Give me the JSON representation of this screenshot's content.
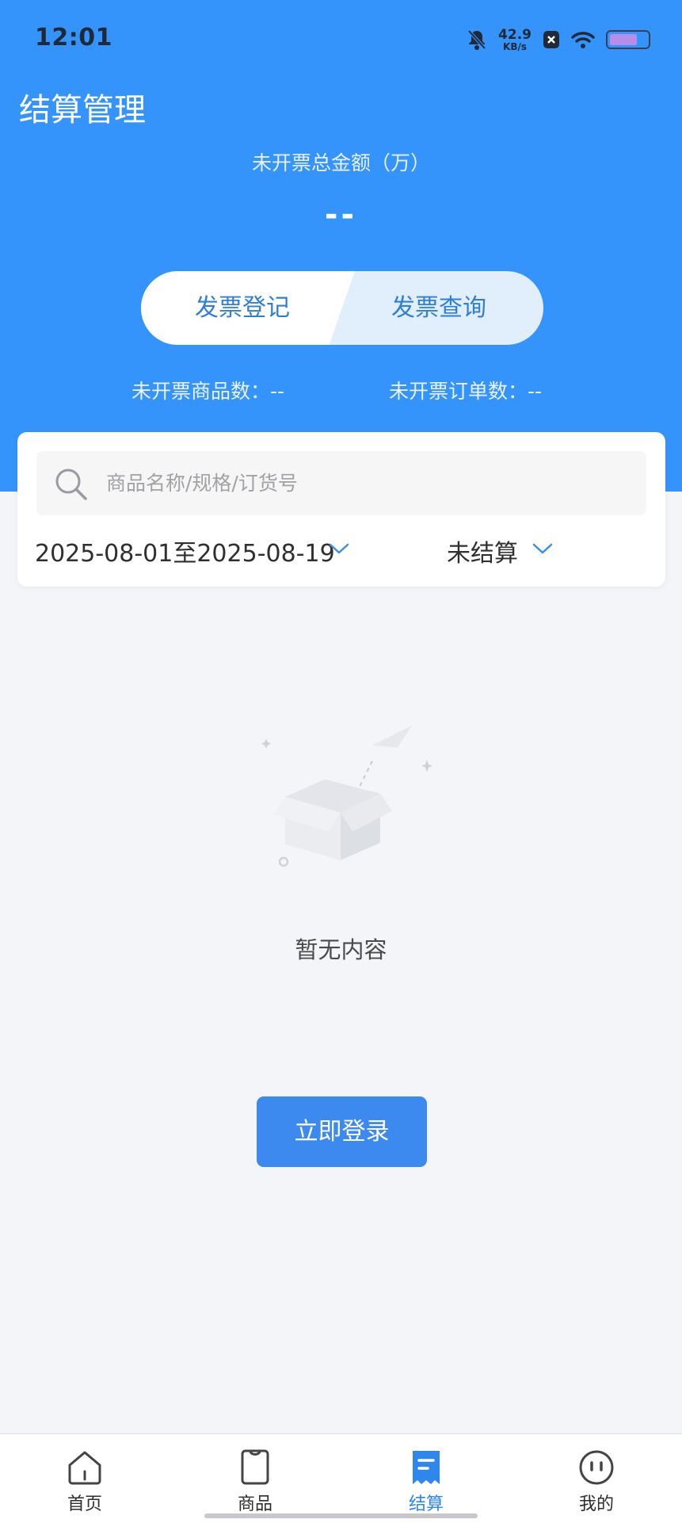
{
  "status_bar": {
    "time": "12:01",
    "net_speed_value": "42.9",
    "net_speed_unit": "KB/s"
  },
  "header": {
    "title": "结算管理",
    "total_label": "未开票总金额（万）",
    "total_value": "--"
  },
  "segment": {
    "left_label": "发票登记",
    "right_label": "发票查询",
    "selected": "发票登记"
  },
  "counts": {
    "products": "未开票商品数：--",
    "orders": "未开票订单数：--"
  },
  "search": {
    "placeholder": "商品名称/规格/订货号"
  },
  "filters": {
    "date_range": "2025-08-01至2025-08-19",
    "status": "未结算"
  },
  "empty": {
    "text": "暂无内容"
  },
  "login_button": "立即登录",
  "tabbar": {
    "items": [
      {
        "label": "首页",
        "icon": "home-icon"
      },
      {
        "label": "商品",
        "icon": "product-icon"
      },
      {
        "label": "结算",
        "icon": "settlement-icon",
        "active": true
      },
      {
        "label": "我的",
        "icon": "profile-icon"
      }
    ]
  },
  "colors": {
    "primary": "#3594fb",
    "button": "#3c89f0",
    "active_tab": "#2f86ec",
    "background": "#f3f5f9"
  }
}
